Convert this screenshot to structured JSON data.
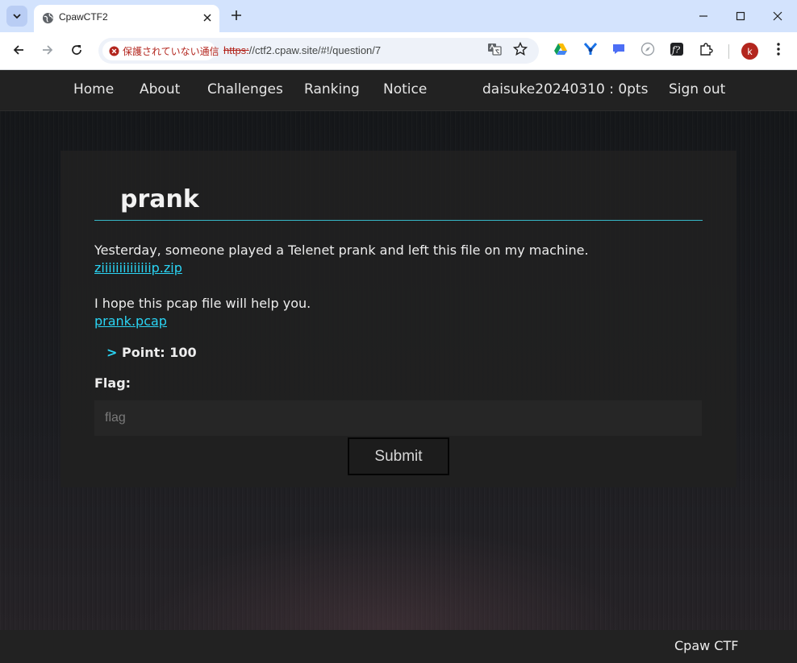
{
  "browser": {
    "tab_title": "CpawCTF2",
    "security_label": "保護されていない通信",
    "url_scheme": "https:",
    "url_rest": "//ctf2.cpaw.site/#!/question/7",
    "profile_initial": "k",
    "icons": [
      "tab-search-icon",
      "globe-icon",
      "close-icon",
      "plus-icon",
      "minimize-icon",
      "maximize-icon",
      "back-icon",
      "forward-icon",
      "reload-icon",
      "warning-icon",
      "translate-icon",
      "star-icon",
      "drive-icon",
      "extension-icon",
      "chat-icon",
      "compass-icon",
      "formula-icon",
      "puzzle-icon",
      "kebab-menu-icon"
    ]
  },
  "site_nav": {
    "home": "Home",
    "about": "About",
    "challenges": "Challenges",
    "ranking": "Ranking",
    "notice": "Notice",
    "user": "daisuke20240310 : 0pts",
    "sign_out": "Sign out"
  },
  "question": {
    "title": "prank",
    "line1": "Yesterday, someone played a Telenet prank and left this file on my machine.",
    "link1": "ziiiiiiiiiiiiiip.zip",
    "line2": "I hope this pcap file will help you.",
    "link2": "prank.pcap",
    "points_arrow": ">",
    "points": "Point: 100",
    "flag_label": "Flag:",
    "flag_placeholder": "flag",
    "submit": "Submit"
  },
  "footer": {
    "text": "Cpaw CTF"
  },
  "colors": {
    "accent": "#2ad4f4",
    "rule": "#37b8c8",
    "nav_bg": "#222222",
    "security_red": "#b3261e"
  }
}
